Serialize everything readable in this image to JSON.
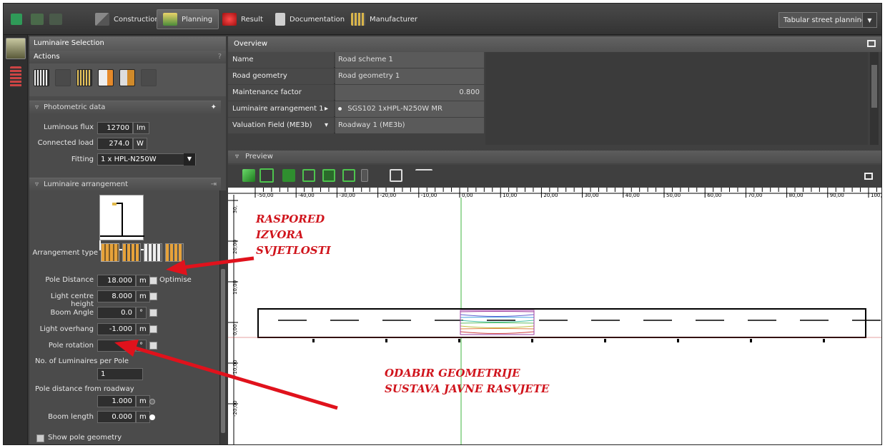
{
  "toolbar": {
    "tabs": [
      {
        "label": "Construction"
      },
      {
        "label": "Planning"
      },
      {
        "label": "Result"
      },
      {
        "label": "Documentation"
      },
      {
        "label": "Manufacturer"
      }
    ],
    "mode_select": "Tabular street planning"
  },
  "left_panel": {
    "title": "Luminaire Selection",
    "actions_label": "Actions",
    "help": "?",
    "photometric": {
      "title": "Photometric data",
      "luminous_flux_label": "Luminous flux",
      "luminous_flux_value": "12700",
      "luminous_flux_unit": "lm",
      "connected_load_label": "Connected load",
      "connected_load_value": "274.0",
      "connected_load_unit": "W",
      "fitting_label": "Fitting",
      "fitting_value": "1 x HPL-N250W"
    },
    "arrangement": {
      "title": "Luminaire arrangement",
      "type_label": "Arrangement type",
      "pole_distance_label": "Pole Distance",
      "pole_distance_value": "18.000",
      "pole_distance_unit": "m",
      "optimise_label": "Optimise",
      "light_centre_height_label": "Light centre height",
      "light_centre_height_value": "8.000",
      "light_centre_height_unit": "m",
      "boom_angle_label": "Boom Angle",
      "boom_angle_value": "0.0",
      "boom_angle_unit": "°",
      "light_overhang_label": "Light overhang",
      "light_overhang_value": "-1.000",
      "light_overhang_unit": "m",
      "pole_rotation_label": "Pole rotation",
      "pole_rotation_value": "0.0",
      "pole_rotation_unit": "°",
      "luminaires_per_pole_label": "No. of Luminaires per Pole",
      "luminaires_per_pole_value": "1",
      "pole_distance_roadway_label": "Pole distance from roadway",
      "pole_distance_roadway_value": "1.000",
      "pole_distance_roadway_unit": "m",
      "boom_length_label": "Boom length",
      "boom_length_value": "0.000",
      "boom_length_unit": "m",
      "show_pole_geometry_label": "Show pole geometry"
    }
  },
  "overview": {
    "title": "Overview",
    "rows": [
      {
        "label": "Name",
        "value": "Road scheme 1"
      },
      {
        "label": "Road geometry",
        "value": "Road geometry 1"
      },
      {
        "label": "Maintenance factor",
        "value": "0.800"
      },
      {
        "label": "Luminaire arrangement 1",
        "value": "SGS102 1xHPL-N250W MR"
      },
      {
        "label": "Valuation Field (ME3b)",
        "value": "Roadway 1 (ME3b)"
      }
    ]
  },
  "preview": {
    "title": "Preview",
    "x_ticks": [
      "-50,00",
      "-40,00",
      "-30,00",
      "-20,00",
      "-10,00",
      "0,00",
      "10,00",
      "20,00",
      "30,00",
      "40,00",
      "50,00",
      "60,00",
      "70,00",
      "80,00",
      "90,00",
      "100,00"
    ],
    "y_ticks": [
      "30,",
      "20,00",
      "10,00",
      "0,00",
      "-10,00",
      "-20,00"
    ]
  },
  "annotations": {
    "arrangement_note": [
      "RASPORED",
      "IZVORA",
      "SVJETLOSTI"
    ],
    "geometry_note": [
      "ODABIR GEOMETRIJE",
      "SUSTAVA JAVNE RASVJETE"
    ]
  },
  "colors": {
    "annotation": "#d0141c",
    "accent_green": "#3fb53f",
    "panel": "#4b4b4b"
  }
}
